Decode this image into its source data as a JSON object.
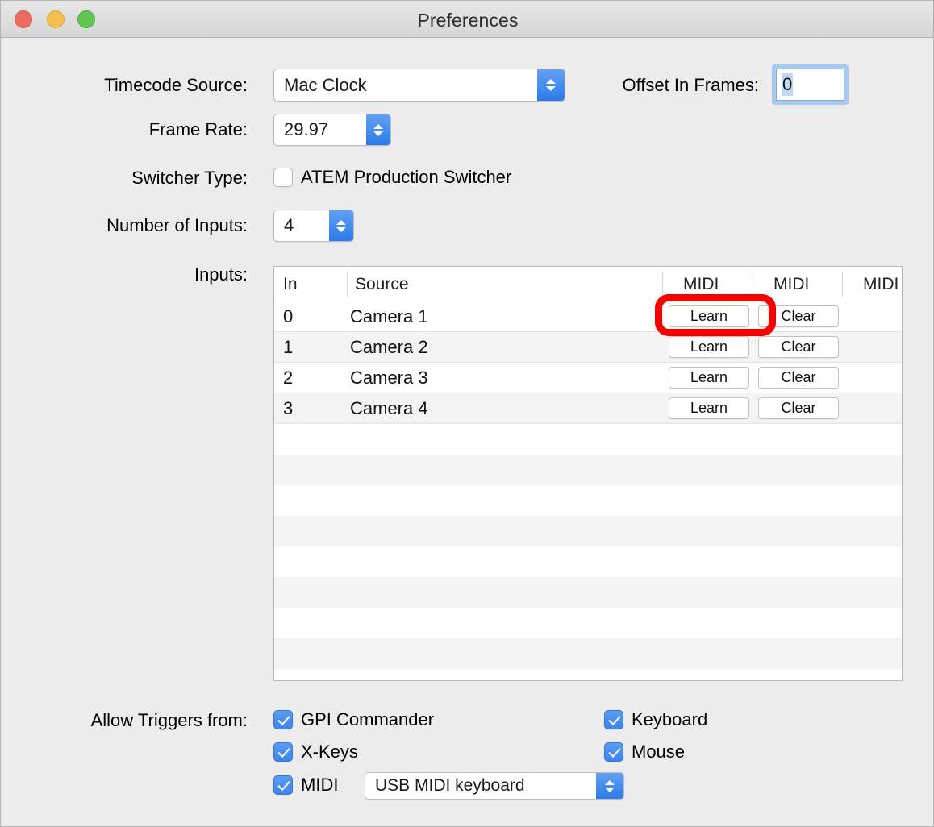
{
  "window": {
    "title": "Preferences",
    "traffic_lights": [
      "close-button",
      "minimize-button",
      "zoom-button"
    ]
  },
  "form": {
    "timecode_source": {
      "label": "Timecode Source:",
      "value": "Mac Clock",
      "control": "popup-button"
    },
    "offset_in_frames": {
      "label": "Offset In Frames:",
      "value": "0",
      "focused": true,
      "selected": true
    },
    "frame_rate": {
      "label": "Frame Rate:",
      "value": "29.97",
      "control": "stepper"
    },
    "switcher_type": {
      "label": "Switcher Type:",
      "checkbox_label": "ATEM Production Switcher",
      "checked": false
    },
    "number_of_inputs": {
      "label": "Number of Inputs:",
      "value": "4",
      "control": "stepper"
    },
    "inputs": {
      "label": "Inputs:"
    }
  },
  "table": {
    "columns": [
      "In",
      "Source",
      "MIDI",
      "MIDI",
      "MIDI"
    ],
    "rows": [
      {
        "in": "0",
        "source": "Camera 1",
        "learn": "Learn",
        "clear": "Clear"
      },
      {
        "in": "1",
        "source": "Camera 2",
        "learn": "Learn",
        "clear": "Clear"
      },
      {
        "in": "2",
        "source": "Camera 3",
        "learn": "Learn",
        "clear": "Clear"
      },
      {
        "in": "3",
        "source": "Camera 4",
        "learn": "Learn",
        "clear": "Clear"
      }
    ],
    "empty_row_count": 8
  },
  "triggers": {
    "label": "Allow Triggers from:",
    "items": [
      {
        "name": "gpi-commander",
        "label": "GPI Commander",
        "checked": true
      },
      {
        "name": "x-keys",
        "label": "X-Keys",
        "checked": true
      },
      {
        "name": "midi",
        "label": "MIDI",
        "checked": true
      },
      {
        "name": "keyboard",
        "label": "Keyboard",
        "checked": true
      },
      {
        "name": "mouse",
        "label": "Mouse",
        "checked": true
      }
    ],
    "midi_device": {
      "value": "USB MIDI keyboard",
      "control": "popup-button"
    }
  },
  "colors": {
    "window_background": "#ececec",
    "titlebar_top": "#e8e8e8",
    "titlebar_bottom": "#d6d6d6",
    "accent_blue": "#3d84ee",
    "annotation_red": "#f80000",
    "row_stripe": "#f4f4f4"
  }
}
